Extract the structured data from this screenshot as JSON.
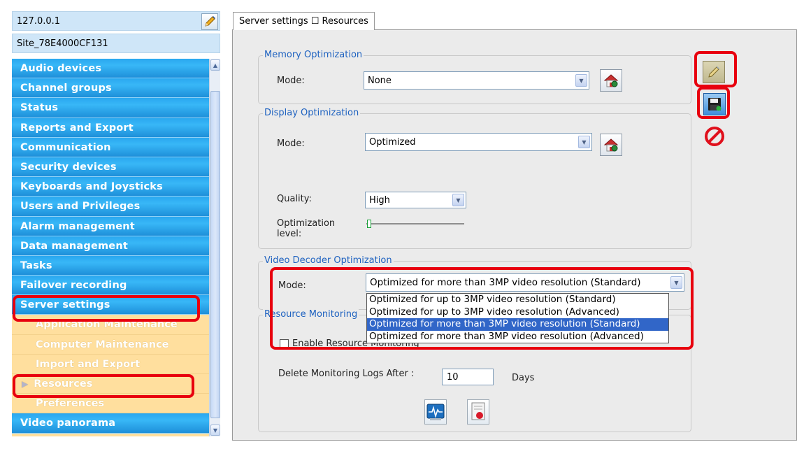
{
  "header": {
    "host": "127.0.0.1",
    "site": "Site_78E4000CF131",
    "top_right_fragment": "* ... ..."
  },
  "nav": {
    "items": [
      {
        "label": "Audio devices"
      },
      {
        "label": "Channel groups"
      },
      {
        "label": "Status"
      },
      {
        "label": "Reports and Export"
      },
      {
        "label": "Communication"
      },
      {
        "label": "Security devices"
      },
      {
        "label": "Keyboards and Joysticks"
      },
      {
        "label": "Users and Privileges"
      },
      {
        "label": "Alarm management"
      },
      {
        "label": "Data management"
      },
      {
        "label": "Tasks"
      },
      {
        "label": "Failover recording"
      },
      {
        "label": "Server settings"
      }
    ],
    "subitems": [
      {
        "label": "Application Maintenance"
      },
      {
        "label": "Computer Maintenance"
      },
      {
        "label": "Import and Export"
      },
      {
        "label": "Resources"
      },
      {
        "label": "Preferences"
      }
    ],
    "last_item": "Video panorama",
    "scroll_up_icon": "up-arrow-icon",
    "scroll_down_icon": "down-arrow-icon"
  },
  "tab": {
    "label": "Server settings ☐ Resources"
  },
  "memory": {
    "legend": "Memory Optimization",
    "mode_label": "Mode:",
    "mode_value": "None"
  },
  "display": {
    "legend": "Display Optimization",
    "mode_label": "Mode:",
    "mode_value": "Optimized",
    "quality_label": "Quality:",
    "quality_value": "High",
    "opt_level_label_1": "Optimization",
    "opt_level_label_2": "level:"
  },
  "video": {
    "legend": "Video Decoder Optimization",
    "mode_label": "Mode:",
    "mode_value": "Optimized for more than 3MP video resolution (Standard)",
    "options": [
      "Optimized for up to 3MP video resolution (Standard)",
      "Optimized for up to 3MP video resolution (Advanced)",
      "Optimized for more than 3MP video resolution (Standard)",
      "Optimized for more than 3MP video resolution (Advanced)"
    ],
    "highlighted_option_index": 2
  },
  "monitoring": {
    "legend": "Resource Monitoring",
    "enable_label": "Enable Resource Monitoring",
    "delete_label": "Delete Monitoring Logs After :",
    "delete_value": "10",
    "days_label": "Days"
  },
  "colors": {
    "nav_blue": "#2aa7ef",
    "nav_sub_bg": "#ffdf9e",
    "legend_blue": "#1e62c0",
    "highlight_red": "#e8000e",
    "selection_blue": "#3166c8"
  }
}
